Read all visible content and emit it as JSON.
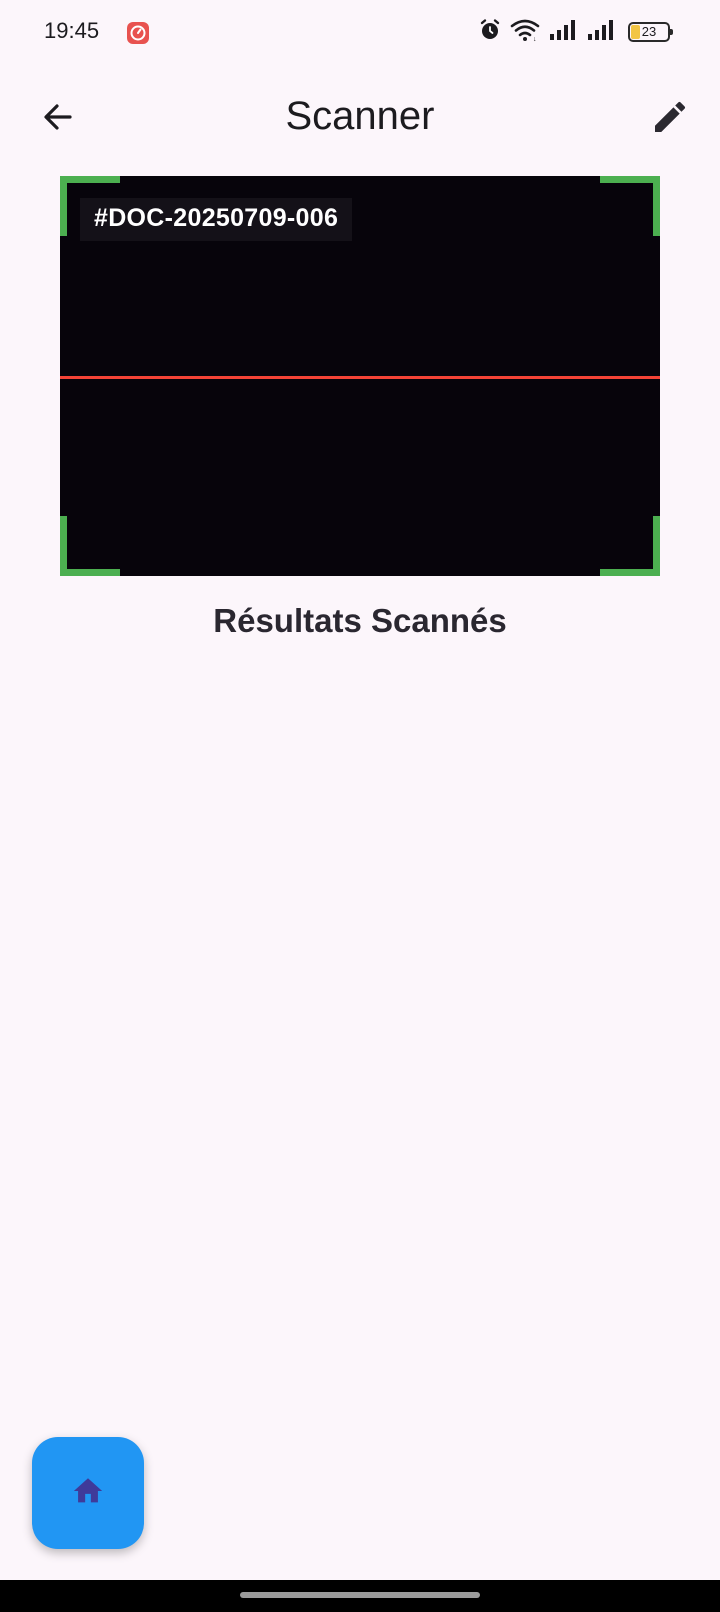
{
  "status_bar": {
    "time": "19:45",
    "battery_level": "23",
    "icons": [
      "app-notification-icon",
      "alarm-icon",
      "wifi-icon",
      "signal-icon",
      "signal-icon",
      "battery-icon"
    ]
  },
  "app_bar": {
    "title": "Scanner",
    "back_icon": "arrow-left-icon",
    "edit_icon": "pencil-icon"
  },
  "scanner": {
    "detected_code": "#DOC-20250709-006",
    "frame_color": "#4caf50",
    "scan_line_color": "#f44336"
  },
  "results": {
    "title": "Résultats Scannés"
  },
  "fab": {
    "icon": "home-icon",
    "color": "#2196f3"
  }
}
